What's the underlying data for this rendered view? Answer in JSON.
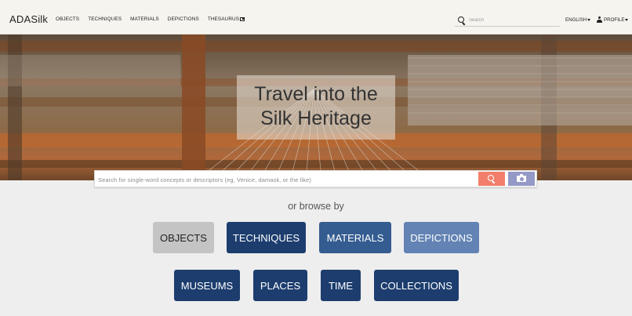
{
  "navbar": {
    "brand": "ADASilk",
    "links": [
      "OBJECTS",
      "TECHNIQUES",
      "MATERIALS",
      "DEPICTIONS",
      "THESAURUS"
    ],
    "search_placeholder": "Search",
    "language": "ENGLISH",
    "profile": "PROFILE"
  },
  "hero": {
    "title_line1": "Travel into the",
    "title_line2": "Silk Heritage"
  },
  "main_search": {
    "placeholder": "Search for single-word concepts or descriptors (eg, Venice, damask, or the like)"
  },
  "browse": {
    "label": "or browse by",
    "row1": [
      "OBJECTS",
      "TECHNIQUES",
      "MATERIALS",
      "DEPICTIONS"
    ],
    "row2": [
      "MUSEUMS",
      "PLACES",
      "TIME",
      "COLLECTIONS"
    ]
  },
  "colors": {
    "objects_button": "#c4c4c4",
    "techniques_button": "#1c3d6e",
    "materials_button": "#345c90",
    "depictions_button": "#6283b3",
    "row2_button": "#1c3d6e",
    "search_button": "#f27f6b",
    "camera_button": "#9499c7"
  }
}
